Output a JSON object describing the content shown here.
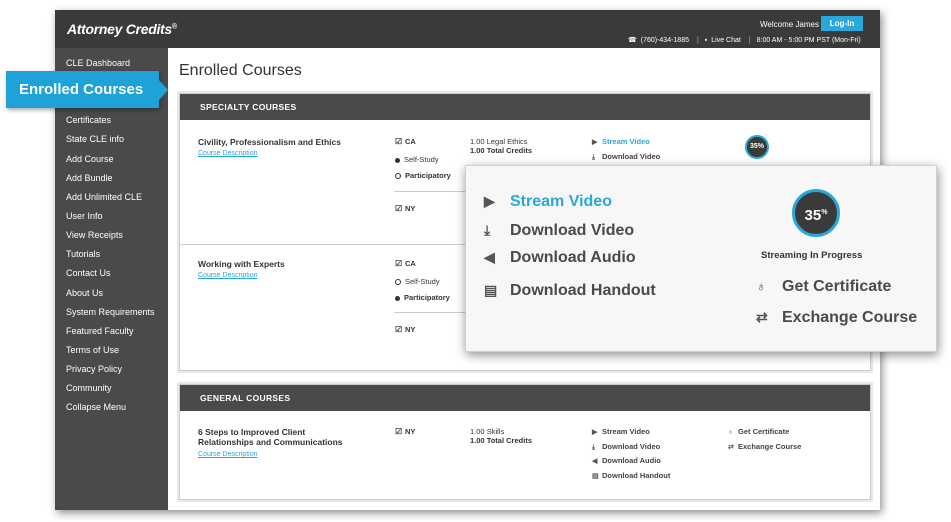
{
  "header": {
    "logo": "Attorney Credits",
    "logo_mark": "®",
    "welcome": "Welcome James",
    "login_label": "Log-In",
    "phone": "(760)-434-1885",
    "chat": "Live Chat",
    "hours": "8:00 AM - 5:00 PM PST (Mon-Fri)"
  },
  "sidebar": {
    "items": [
      "CLE Dashboard",
      "Certificates",
      "State CLE info",
      "Add Course",
      "Add Bundle",
      "Add Unlimited CLE",
      "User Info",
      "View Receipts",
      "Tutorials",
      "Contact Us",
      "About Us",
      "System Requirements",
      "Featured Faculty",
      "Terms of Use",
      "Privacy Policy",
      "Community",
      "Collapse Menu"
    ],
    "active": "Enrolled Courses"
  },
  "main": {
    "title": "Enrolled Courses",
    "specialty": {
      "heading": "SPECIALTY COURSES",
      "courses": [
        {
          "name": "Civility, Professionalism and Ethics",
          "link": "Course Description",
          "state1": "CA",
          "opt1": "Self-Study",
          "opt2": "Participatory",
          "state2": "NY",
          "credit1": "1.00",
          "credit1_label": "Legal Ethics",
          "credit2": "1.00",
          "credit2_label": "Total Credits",
          "action1": "Stream Video",
          "action2": "Download Video",
          "progress": "35%"
        },
        {
          "name": "Working with Experts",
          "link": "Course Description",
          "state1": "CA",
          "opt1": "Self-Study",
          "opt2": "Participatory",
          "state2": "NY"
        }
      ]
    },
    "general": {
      "heading": "GENERAL COURSES",
      "course": {
        "name_line1": "6 Steps to Improved Client",
        "name_line2": "Relationships and Communications",
        "link": "Course Description",
        "state": "NY",
        "credit1": "1.00",
        "credit1_label": "Skills",
        "credit2": "1.00",
        "credit2_label": "Total Credits",
        "actions": [
          "Stream Video",
          "Download Video",
          "Download Audio",
          "Download Handout"
        ],
        "cert": "Get Certificate",
        "exchange": "Exchange Course"
      }
    }
  },
  "zoom": {
    "actions": [
      "Stream Video",
      "Download Video",
      "Download Audio",
      "Download Handout"
    ],
    "progress_value": "35",
    "progress_unit": "%",
    "progress_label": "Streaming In Progress",
    "cert": "Get Certificate",
    "exchange": "Exchange Course"
  },
  "colors": {
    "accent": "#2aa8dc",
    "dark": "#3a3a3a",
    "sidebar": "#4a4a4a"
  }
}
